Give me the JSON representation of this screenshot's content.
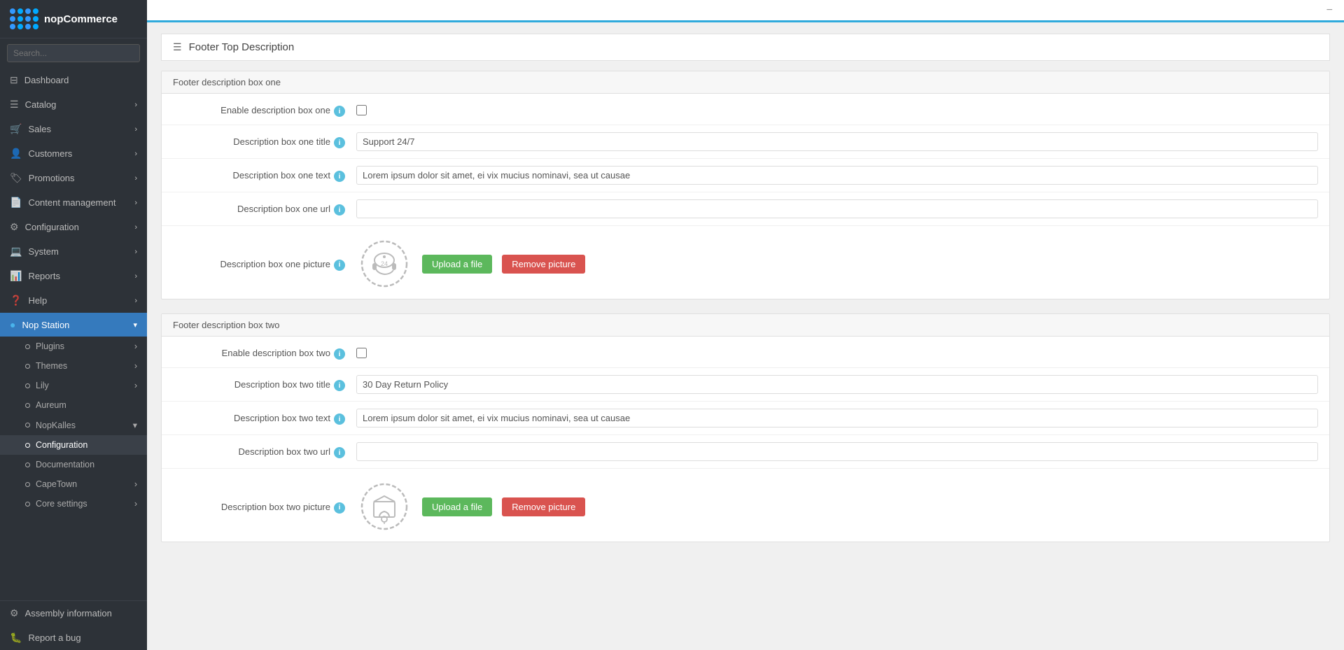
{
  "sidebar": {
    "logo_text": "nopCommerce",
    "search_placeholder": "Search...",
    "items": [
      {
        "id": "dashboard",
        "label": "Dashboard",
        "icon": "⊟",
        "has_arrow": false,
        "active": false
      },
      {
        "id": "catalog",
        "label": "Catalog",
        "icon": "📋",
        "has_arrow": true,
        "active": false
      },
      {
        "id": "sales",
        "label": "Sales",
        "icon": "🛒",
        "has_arrow": true,
        "active": false
      },
      {
        "id": "customers",
        "label": "Customers",
        "icon": "👤",
        "has_arrow": true,
        "active": false
      },
      {
        "id": "promotions",
        "label": "Promotions",
        "icon": "🏷",
        "has_arrow": true,
        "active": false
      },
      {
        "id": "content-management",
        "label": "Content management",
        "icon": "📄",
        "has_arrow": true,
        "active": false
      },
      {
        "id": "configuration",
        "label": "Configuration",
        "icon": "⚙",
        "has_arrow": true,
        "active": false
      },
      {
        "id": "system",
        "label": "System",
        "icon": "💻",
        "has_arrow": true,
        "active": false
      },
      {
        "id": "reports",
        "label": "Reports",
        "icon": "📊",
        "has_arrow": true,
        "active": false
      },
      {
        "id": "help",
        "label": "Help",
        "icon": "❓",
        "has_arrow": true,
        "active": false
      },
      {
        "id": "nop-station",
        "label": "Nop Station",
        "icon": "●",
        "has_arrow": true,
        "active": true
      }
    ],
    "sub_items": [
      {
        "id": "plugins",
        "label": "Plugins",
        "has_arrow": true
      },
      {
        "id": "themes",
        "label": "Themes",
        "has_arrow": true
      },
      {
        "id": "lily",
        "label": "Lily",
        "has_arrow": true
      },
      {
        "id": "aureum",
        "label": "Aureum",
        "has_arrow": false
      },
      {
        "id": "nopkalles",
        "label": "NopKalles",
        "has_arrow": true
      },
      {
        "id": "configuration-sub",
        "label": "Configuration",
        "has_arrow": false,
        "active": true
      },
      {
        "id": "documentation",
        "label": "Documentation",
        "has_arrow": false
      },
      {
        "id": "capetown",
        "label": "CapeTown",
        "has_arrow": true
      },
      {
        "id": "core-settings",
        "label": "Core settings",
        "has_arrow": true
      }
    ],
    "bottom_items": [
      {
        "id": "assembly-information",
        "label": "Assembly information",
        "icon": "⚙"
      },
      {
        "id": "report-a-bug",
        "label": "Report a bug",
        "icon": "🐛"
      }
    ]
  },
  "topbar": {
    "minimize_label": "−"
  },
  "page": {
    "title": "Footer Top Description",
    "section_one": {
      "header": "Footer description box one",
      "enable_label": "Enable description box one",
      "title_label": "Description box one title",
      "title_value": "Support 24/7",
      "text_label": "Description box one text",
      "text_value": "Lorem ipsum dolor sit amet, ei vix mucius nominavi, sea ut causae",
      "url_label": "Description box one url",
      "url_value": "",
      "picture_label": "Description box one picture",
      "upload_btn": "Upload a file",
      "remove_btn": "Remove picture"
    },
    "section_two": {
      "header": "Footer description box two",
      "enable_label": "Enable description box two",
      "title_label": "Description box two title",
      "title_value": "30 Day Return Policy",
      "text_label": "Description box two text",
      "text_value": "Lorem ipsum dolor sit amet, ei vix mucius nominavi, sea ut causae",
      "url_label": "Description box two url",
      "url_value": "",
      "picture_label": "Description box two picture",
      "upload_btn": "Upload a file",
      "remove_btn": "Remove picture"
    }
  }
}
